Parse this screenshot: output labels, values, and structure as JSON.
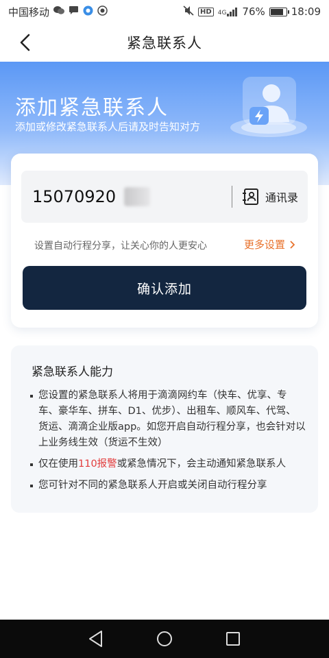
{
  "status_bar": {
    "carrier": "中国移动",
    "battery_percent": "76%",
    "time": "18:09",
    "network": "4G",
    "hd": "HD",
    "battery_level": 0.76
  },
  "nav": {
    "title": "紧急联系人",
    "back_icon": "chevron-left-icon"
  },
  "hero": {
    "title": "添加紧急联系人",
    "subtitle": "添加或修改紧急联系人后请及时告知对方",
    "illustration_icon": "contact-shield-icon"
  },
  "form": {
    "phone_value": "15070920",
    "contacts_label": "通讯录",
    "share_hint": "设置自动行程分享，让关心你的人更安心",
    "more_settings": "更多设置",
    "confirm_label": "确认添加"
  },
  "ability": {
    "title": "紧急联系人能力",
    "item1": "您设置的紧急联系人将用于滴滴网约车（快车、优享、专车、豪华车、拼车、D1、优步）、出租车、顺风车、代驾、货运、滴滴企业版app。如您开启自动行程分享，也会针对以上业务线生效（货运不生效）",
    "item2_prefix": "仅在使用",
    "item2_highlight": "110报警",
    "item2_suffix": "或紧急情况下，会主动通知紧急联系人",
    "item3": "您可针对不同的紧急联系人开启或关闭自动行程分享"
  },
  "colors": {
    "accent_orange": "#e8712b",
    "primary_button": "#132640",
    "hero_blue": "#5b98f5",
    "highlight_red": "#e23c3c"
  }
}
